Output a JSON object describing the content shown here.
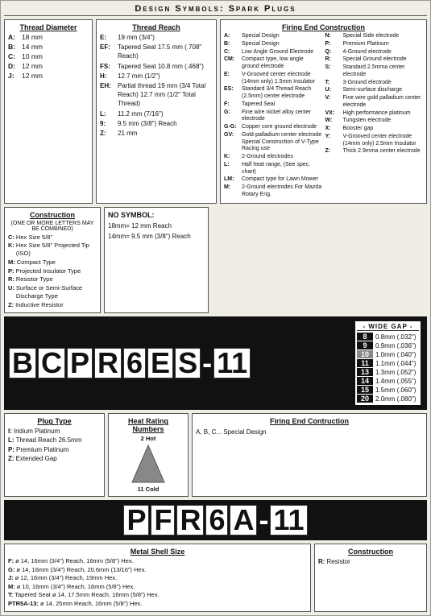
{
  "page": {
    "title": "Design Symbols: Spark Plugs"
  },
  "threadDiameter": {
    "title": "Thread Diameter",
    "rows": [
      {
        "label": "A:",
        "value": "18 mm"
      },
      {
        "label": "B:",
        "value": "14 mm"
      },
      {
        "label": "C:",
        "value": "10 mm"
      },
      {
        "label": "D:",
        "value": "12 mm"
      },
      {
        "label": "J:",
        "value": "12 mm"
      }
    ]
  },
  "threadReach": {
    "title": "Thread Reach",
    "rows": [
      {
        "label": "E:",
        "value": "19 mm (3/4\")"
      },
      {
        "label": "EF:",
        "value": "Tapered Seat 17.5 mm (.708\" Reach)"
      },
      {
        "label": "FS:",
        "value": "Tapered Seat 10.8 mm (.468\")"
      },
      {
        "label": "H:",
        "value": "12.7 mm (1/2\")"
      },
      {
        "label": "EH:",
        "value": "Partial thread 19 mm (3/4 Total Reach) 12.7 mm (1/2\" Total Thread)"
      },
      {
        "label": "L:",
        "value": "11.2 mm (7/16\")"
      },
      {
        "label": "9:",
        "value": "9.5 mm (3/8\") Reach"
      },
      {
        "label": "Z:",
        "value": "21 mm"
      }
    ]
  },
  "noSymbol": {
    "title": "NO SYMBOL:",
    "rows": [
      "18mm= 12 mm Reach",
      "14mm= 9.5 mm (3/8\") Reach"
    ]
  },
  "firingEndTop": {
    "title": "Firing End Construction",
    "left": [
      {
        "label": "A:",
        "value": "Special Design"
      },
      {
        "label": "B:",
        "value": "Special Design"
      },
      {
        "label": "C:",
        "value": "Low Angle Ground Electrode"
      },
      {
        "label": "CM:",
        "value": "Compact type, low angle ground electrode"
      },
      {
        "label": "E:",
        "value": "V-Grooved center electrode (14mm only) 1.5mm Insulator"
      },
      {
        "label": "ES:",
        "value": "Standard 3/4 Thread Reach (2.5mm) center electrode"
      },
      {
        "label": "F:",
        "value": "Tapered Seal"
      },
      {
        "label": "G:",
        "value": "Fine wire nickel alloy center electrode"
      },
      {
        "label": "G-G:",
        "value": "Copper core ground electrode"
      },
      {
        "label": "GV:",
        "value": "Gold-palladium center electrode Special Construction of V-Type Racing use"
      },
      {
        "label": "K:",
        "value": "2-Ground electrodes"
      },
      {
        "label": "L:",
        "value": "Half heat range, (See spec. chart)"
      },
      {
        "label": "LM:",
        "value": "Compact type for Lawn Mower"
      },
      {
        "label": "M:",
        "value": "2-Ground electrodes For Mazda Rotary Eng."
      }
    ],
    "right": [
      {
        "label": "N:",
        "value": "Special Side electrode"
      },
      {
        "label": "P:",
        "value": "Premium Platinum"
      },
      {
        "label": "Q:",
        "value": "4-Ground electrode"
      },
      {
        "label": "R:",
        "value": "Special Ground electrode"
      },
      {
        "label": "S:",
        "value": "Standard 2.5mma center electrode"
      },
      {
        "label": "T:",
        "value": "3-Ground electrode"
      },
      {
        "label": "U:",
        "value": "Semi-surface discharge"
      },
      {
        "label": "V:",
        "value": "Fine wire gold palladium center electrode"
      },
      {
        "label": "VX:",
        "value": "High performance platinum"
      },
      {
        "label": "W:",
        "value": "Tungsten electrode"
      },
      {
        "label": "X:",
        "value": "Booster gap"
      },
      {
        "label": "Y:",
        "value": "V-Grooved center electrode (14mm only) 2.5mm Insulator"
      },
      {
        "label": "Z:",
        "value": "Thick 2.9mma center electrode"
      }
    ]
  },
  "construction": {
    "title": "Construction",
    "subtitle": "(ONE OR MORE LETTERS MAY BE COMBINED)",
    "rows": [
      {
        "label": "C:",
        "value": "Hex Size 5/8\""
      },
      {
        "label": "K:",
        "value": "Hex Size 5/8\" Projected Tip (ISO)"
      },
      {
        "label": "M:",
        "value": "Compact Type"
      },
      {
        "label": "P:",
        "value": "Projected Insulator Type"
      },
      {
        "label": "R:",
        "value": "Resistor Type"
      },
      {
        "label": "U:",
        "value": "Surface or Semi-Surface Discharge Type"
      },
      {
        "label": "Z:",
        "value": "Inductive Resistor"
      }
    ]
  },
  "bigLetters1": {
    "letters": [
      "B",
      "C",
      "P",
      "R",
      "6",
      "E",
      "S"
    ],
    "dash": "-",
    "number": "11"
  },
  "wideGap": {
    "title": "- WIDE GAP -",
    "items": [
      {
        "num": "8",
        "value": "0.8mm (.032\")",
        "highlight": false
      },
      {
        "num": "9",
        "value": "0.9mm (.036\")"
      },
      {
        "num": "10",
        "value": "1.0mm (.040\")",
        "highlight": true
      },
      {
        "num": "11",
        "value": "1.1mm (.044\")"
      },
      {
        "num": "13",
        "value": "1.3mm (.052\")"
      },
      {
        "num": "14",
        "value": "1.4mm (.055\")"
      },
      {
        "num": "15",
        "value": "1.5mm (.060\")"
      },
      {
        "num": "20",
        "value": "2.0mm (.080\")"
      }
    ]
  },
  "plugType": {
    "title": "Plug Type",
    "rows": [
      {
        "label": "I:",
        "value": "Iridium Platinum"
      },
      {
        "label": "L:",
        "value": "Thread Reach 26.5mm"
      },
      {
        "label": "P:",
        "value": "Premium Platinum"
      },
      {
        "label": "Z:",
        "value": "Extended Gap"
      }
    ]
  },
  "heatRating": {
    "title": "Heat Rating Numbers",
    "hot": "2 Hot",
    "cold": "11 Cold"
  },
  "firingContruction": {
    "title": "Firing End Contruction",
    "value": "A, B, C... Special Design"
  },
  "bigLetters2": {
    "letters": [
      "P",
      "F",
      "R",
      "6",
      "A"
    ],
    "dash": "-",
    "number": "11"
  },
  "metalShell": {
    "title": "Metal Shell Size",
    "rows": [
      {
        "label": "F:",
        "value": "ø 14, 16mm (3/4\") Reach, 16mm (5/8\") Hex."
      },
      {
        "label": "G:",
        "value": "ø 14, 16mm (3/4\") Reach, 20.6mm (13/16\") Hex."
      },
      {
        "label": "J:",
        "value": "ø 12, 16mm (3/4\") Reach, 19mm Hex."
      },
      {
        "label": "M:",
        "value": "ø 10, 16mm (3/4\") Reach, 16mm (5/8\") Hex."
      },
      {
        "label": "T:",
        "value": "Tapered Seat ø 14, 17.5mm Reach, 16mm (5/8\") Hex."
      },
      {
        "label": "PTR5A-13:",
        "value": "ø 14, 25mm Reach, 16mm (5/8\") Hex."
      }
    ]
  },
  "constructionBottom": {
    "title": "Construction",
    "rows": [
      {
        "label": "R:",
        "value": "Resistor"
      }
    ]
  }
}
